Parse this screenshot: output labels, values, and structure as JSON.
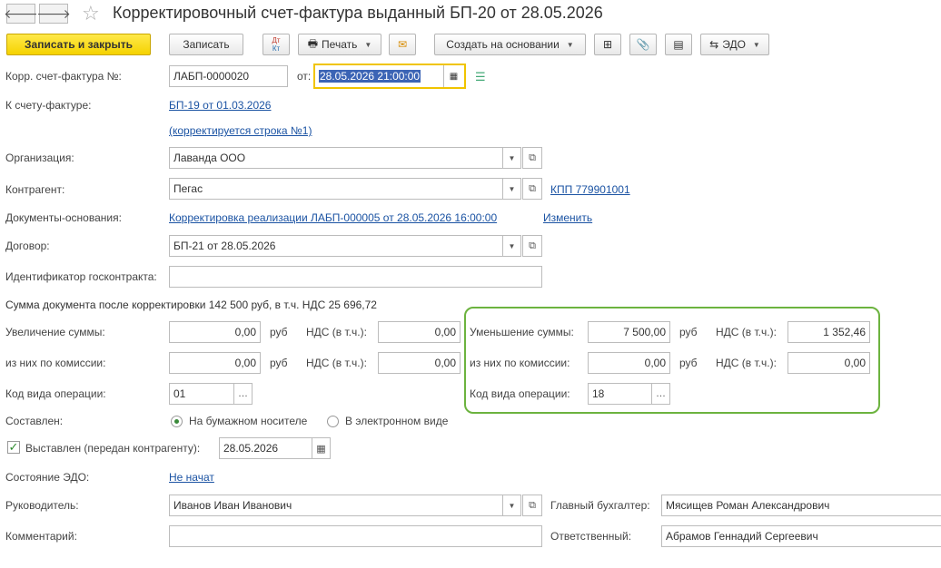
{
  "window": {
    "title": "Корректировочный счет-фактура выданный БП-20 от 28.05.2026"
  },
  "nav": {
    "back": "🡐",
    "forward": "🡒"
  },
  "toolbar": {
    "save_close": "Записать и закрыть",
    "save": "Записать",
    "dtkt_top": "Дт",
    "dtkt_bottom": "Кт",
    "print": "Печать",
    "create_based": "Создать на основании",
    "edo": "ЭДО"
  },
  "form": {
    "number_label": "Корр. счет-фактура №:",
    "number_value": "ЛАБП-0000020",
    "date_label": "от:",
    "date_value": "28.05.2026 21:00:00",
    "to_invoice_label": "К счету-фактуре:",
    "to_invoice_link": "БП-19 от 01.03.2026",
    "corrected_row_link": "(корректируется строка №1)",
    "org_label": "Организация:",
    "org_value": "Лаванда ООО",
    "contractor_label": "Контрагент:",
    "contractor_value": "Пегас",
    "kpp_link": "КПП 779901001",
    "base_docs_label": "Документы-основания:",
    "base_docs_link": "Корректировка реализации ЛАБП-000005 от 28.05.2026 16:00:00",
    "change_link": "Изменить",
    "contract_label": "Договор:",
    "contract_value": "БП-21 от 28.05.2026",
    "gov_id_label": "Идентификатор госконтракта:",
    "gov_id_value": "",
    "sum_after": "Сумма документа после корректировки 142 500 руб, в т.ч. НДС 25 696,72",
    "increase_label": "Увеличение суммы:",
    "increase_value": "0,00",
    "rub": "руб",
    "vat_label": "НДС (в т.ч.):",
    "increase_vat": "0,00",
    "commission_label": "из них по комиссии:",
    "inc_commission_value": "0,00",
    "inc_commission_vat": "0,00",
    "op_code_label": "Код вида операции:",
    "inc_op_code": "01",
    "decrease_label": "Уменьшение суммы:",
    "decrease_value": "7 500,00",
    "decrease_vat": "1 352,46",
    "dec_commission_value": "0,00",
    "dec_commission_vat": "0,00",
    "dec_op_code": "18",
    "composed_label": "Составлен:",
    "paper_option": "На бумажном носителе",
    "electronic_option": "В электронном виде",
    "issued_label": "Выставлен (передан контрагенту):",
    "issued_date": "28.05.2026",
    "edo_state_label": "Состояние ЭДО:",
    "edo_state_link": "Не начат",
    "head_label": "Руководитель:",
    "head_value": "Иванов Иван Иванович",
    "chief_acc_label": "Главный бухгалтер:",
    "chief_acc_value": "Мясищев Роман Александрович",
    "comment_label": "Комментарий:",
    "comment_value": "",
    "responsible_label": "Ответственный:",
    "responsible_value": "Абрамов Геннадий Сергеевич"
  }
}
